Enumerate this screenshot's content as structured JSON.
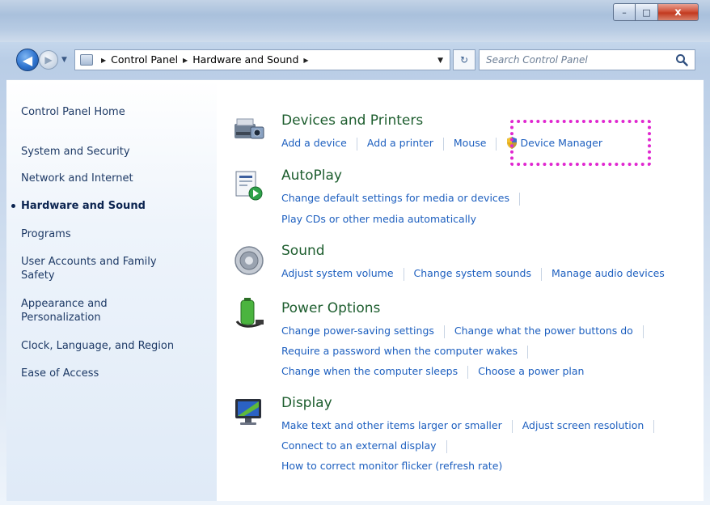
{
  "window": {
    "buttons": {
      "minimize": "–",
      "maximize": "□",
      "close": "x"
    }
  },
  "navigation": {
    "back_icon": "back-arrow-icon",
    "forward_icon": "forward-arrow-icon",
    "breadcrumbs": [
      "Control Panel",
      "Hardware and Sound"
    ],
    "search_placeholder": "Search Control Panel"
  },
  "sidebar": {
    "items": [
      {
        "label": "Control Panel Home",
        "active": false
      },
      {
        "label": "System and Security",
        "active": false
      },
      {
        "label": "Network and Internet",
        "active": false
      },
      {
        "label": "Hardware and Sound",
        "active": true
      },
      {
        "label": "Programs",
        "active": false
      },
      {
        "label": "User Accounts and Family Safety",
        "active": false
      },
      {
        "label": "Appearance and Personalization",
        "active": false
      },
      {
        "label": "Clock, Language, and Region",
        "active": false
      },
      {
        "label": "Ease of Access",
        "active": false
      }
    ]
  },
  "categories": [
    {
      "title": "Devices and Printers",
      "icon": "printer-camera-icon",
      "rows": [
        [
          "Add a device",
          "Add a printer",
          "Mouse",
          "Device Manager"
        ]
      ]
    },
    {
      "title": "AutoPlay",
      "icon": "autoplay-icon",
      "rows": [
        [
          "Change default settings for media or devices"
        ],
        [
          "Play CDs or other media automatically"
        ]
      ]
    },
    {
      "title": "Sound",
      "icon": "speaker-icon",
      "rows": [
        [
          "Adjust system volume",
          "Change system sounds",
          "Manage audio devices"
        ]
      ]
    },
    {
      "title": "Power Options",
      "icon": "battery-icon",
      "rows": [
        [
          "Change power-saving settings",
          "Change what the power buttons do"
        ],
        [
          "Require a password when the computer wakes"
        ],
        [
          "Change when the computer sleeps",
          "Choose a power plan"
        ]
      ]
    },
    {
      "title": "Display",
      "icon": "monitor-icon",
      "rows": [
        [
          "Make text and other items larger or smaller",
          "Adjust screen resolution"
        ],
        [
          "Connect to an external display"
        ],
        [
          "How to correct monitor flicker (refresh rate)"
        ]
      ]
    }
  ],
  "colors": {
    "category_title": "#1e5e2f",
    "link": "#1d5fbf",
    "highlight": "#e028d0"
  }
}
